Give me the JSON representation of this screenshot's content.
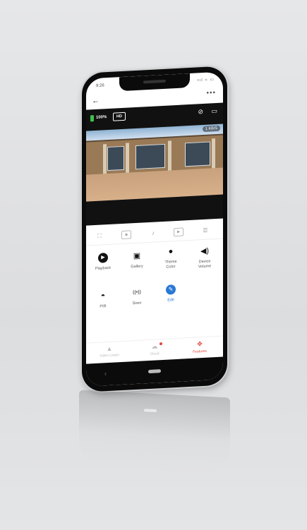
{
  "status_bar": {
    "time": "9:26",
    "signal": "•ıl ≈ ▭"
  },
  "header": {
    "back_icon": "arrow-left-icon",
    "more_label": "•••"
  },
  "camera": {
    "battery_label": "100%",
    "quality_label": "HD",
    "rate_label": "1 KB/S",
    "icons": [
      "mute-icon",
      "fullscreen-icon"
    ]
  },
  "controls": [
    {
      "name": "expand-icon",
      "glyph": "⛶"
    },
    {
      "name": "screenshot-icon",
      "glyph": "◉"
    },
    {
      "name": "microphone-icon",
      "glyph": "🎙"
    },
    {
      "name": "record-icon",
      "glyph": "▶"
    },
    {
      "name": "menu-icon",
      "glyph": "☰"
    }
  ],
  "features": [
    {
      "name": "playback",
      "label": "Playback",
      "icon": "play-icon",
      "glyph": "▶"
    },
    {
      "name": "gallery",
      "label": "Gallery",
      "icon": "image-icon",
      "glyph": "▣"
    },
    {
      "name": "theme-color",
      "label": "Theme\nColor",
      "icon": "palette-icon",
      "glyph": "●"
    },
    {
      "name": "device-volume",
      "label": "Device\nVolume",
      "icon": "speaker-icon",
      "glyph": "🔊"
    },
    {
      "name": "pir",
      "label": "PIR",
      "icon": "sensor-icon",
      "glyph": "◓"
    },
    {
      "name": "siren",
      "label": "Siren",
      "icon": "siren-icon",
      "glyph": "((•))"
    },
    {
      "name": "edit",
      "label": "Edit",
      "icon": "pencil-icon",
      "glyph": "✎"
    }
  ],
  "tabs": [
    {
      "name": "tab-live",
      "label": "Video Lesen",
      "glyph": "▲",
      "active": false
    },
    {
      "name": "tab-cloud",
      "label": "Cloud",
      "glyph": "☁",
      "active": false
    },
    {
      "name": "tab-features",
      "label": "Features",
      "glyph": "✥",
      "active": true
    }
  ],
  "colors": {
    "accent": "#e0453a",
    "edit_blue": "#2a78d6",
    "battery_green": "#3fc04a"
  }
}
